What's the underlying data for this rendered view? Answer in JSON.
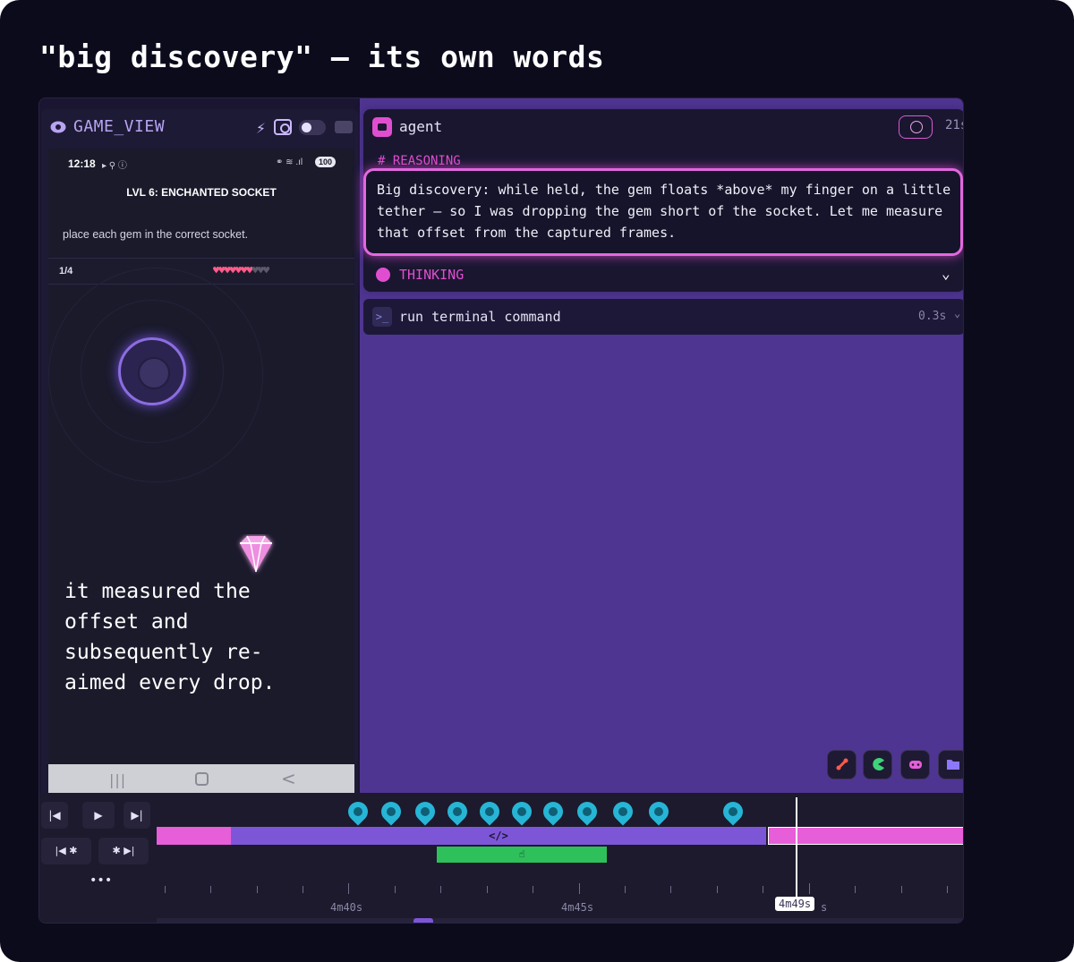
{
  "headline": "\"big discovery\" — its own words",
  "game_view": {
    "title": "GAME_VIEW",
    "status_time": "12:18",
    "status_left_icons": "▸ ⚲ ⓘ",
    "status_right_icons": "⚭ ≋ .ıl",
    "battery": "100",
    "level_title": "LVL 6: ENCHANTED SOCKET",
    "instruction": "place each gem in the correct socket.",
    "progress": "1/4",
    "hearts_full": "♥♥♥♥♥♥♥",
    "hearts_empty": "♥♥♥",
    "lives_remaining": 7,
    "lives_total": 10,
    "caption": "it measured the\noffset and\nsubsequently re-\naimed every drop.",
    "nav_recents": "|||",
    "nav_back": "<"
  },
  "agent": {
    "title": "agent",
    "time": "21s",
    "reasoning_label": "# REASONING",
    "reasoning_text": "Big discovery: while held, the gem floats *above* my finger on a little tether — so I was dropping the gem short of the socket. Let me measure that offset from the captured frames.",
    "thinking_label": "THINKING",
    "thinking_chevron": "⌄"
  },
  "terminal": {
    "icon": ">_",
    "label": "run terminal command",
    "time": "0.3s",
    "chevron": "⌄"
  },
  "timeline": {
    "btn_first": "|◀",
    "btn_play": "▶",
    "btn_last": "▶|",
    "btn_bug_prev": "|◀ ✱",
    "btn_bug_next": "✱ ▶|",
    "more": "•••",
    "code_marker": "</>",
    "click_marker": "☝",
    "tick_labels": [
      "4m40s",
      "4m45s"
    ],
    "playhead_label": "4m49s",
    "tick_suffix": "s"
  },
  "colors": {
    "accent_pink": "#e65ed8",
    "accent_purple": "#7d56d8",
    "accent_green": "#2ec05a",
    "pin_cyan": "#27b5d6"
  }
}
